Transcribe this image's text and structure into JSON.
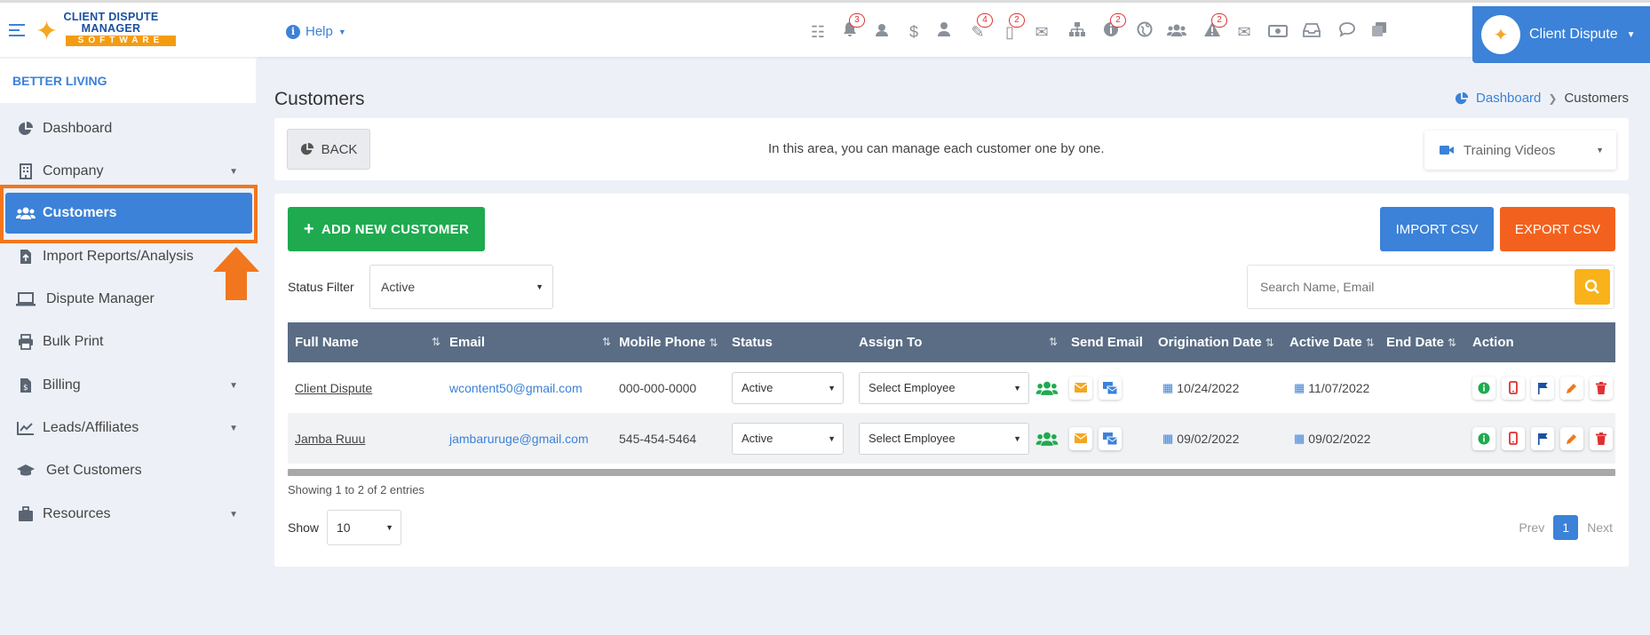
{
  "header": {
    "logo_line1": "CLIENT DISPUTE",
    "logo_line2": "MANAGER",
    "logo_line3": "SOFTWARE",
    "help_label": "Help",
    "user_name": "Client Dispute",
    "badges": {
      "bell": "3",
      "tools": "4",
      "docs": "2",
      "info": "2",
      "alert": "2"
    }
  },
  "sidebar": {
    "company": "BETTER LIVING",
    "items": [
      {
        "label": "Dashboard"
      },
      {
        "label": "Company"
      },
      {
        "label": "Customers"
      },
      {
        "label": "Import Reports/Analysis"
      },
      {
        "label": "Dispute Manager"
      },
      {
        "label": "Bulk Print"
      },
      {
        "label": "Billing"
      },
      {
        "label": "Leads/Affiliates"
      },
      {
        "label": "Get Customers"
      },
      {
        "label": "Resources"
      }
    ]
  },
  "page": {
    "title": "Customers",
    "breadcrumb_home": "Dashboard",
    "breadcrumb_current": "Customers",
    "back_label": "BACK",
    "info_text": "In this area, you can manage each customer one by one.",
    "training_label": "Training Videos"
  },
  "toolbar": {
    "add_label": "ADD NEW CUSTOMER",
    "import_label": "IMPORT CSV",
    "export_label": "EXPORT CSV",
    "status_filter_label": "Status Filter",
    "status_filter_value": "Active",
    "search_placeholder": "Search Name, Email"
  },
  "table": {
    "headers": [
      "Full Name",
      "Email",
      "Mobile Phone",
      "Status",
      "Assign To",
      "Send Email",
      "Origination Date",
      "Active Date",
      "End Date",
      "Action"
    ],
    "rows": [
      {
        "name": "Client Dispute",
        "email": "wcontent50@gmail.com",
        "phone": "000-000-0000",
        "status": "Active",
        "assign": "Select Employee",
        "origination": "10/24/2022",
        "active": "11/07/2022",
        "end": ""
      },
      {
        "name": "Jamba Ruuu",
        "email": "jambaruruge@gmail.com",
        "phone": "545-454-5464",
        "status": "Active",
        "assign": "Select Employee",
        "origination": "09/02/2022",
        "active": "09/02/2022",
        "end": ""
      }
    ]
  },
  "footer": {
    "showing_text": "Showing 1 to 2 of 2 entries",
    "show_label": "Show",
    "page_size": "10",
    "prev": "Prev",
    "page": "1",
    "next": "Next"
  },
  "colors": {
    "accent": "#3b82d8",
    "add": "#1faa4f",
    "export": "#f2621e",
    "highlight": "#f2761e",
    "table_header": "#5a6d85"
  }
}
